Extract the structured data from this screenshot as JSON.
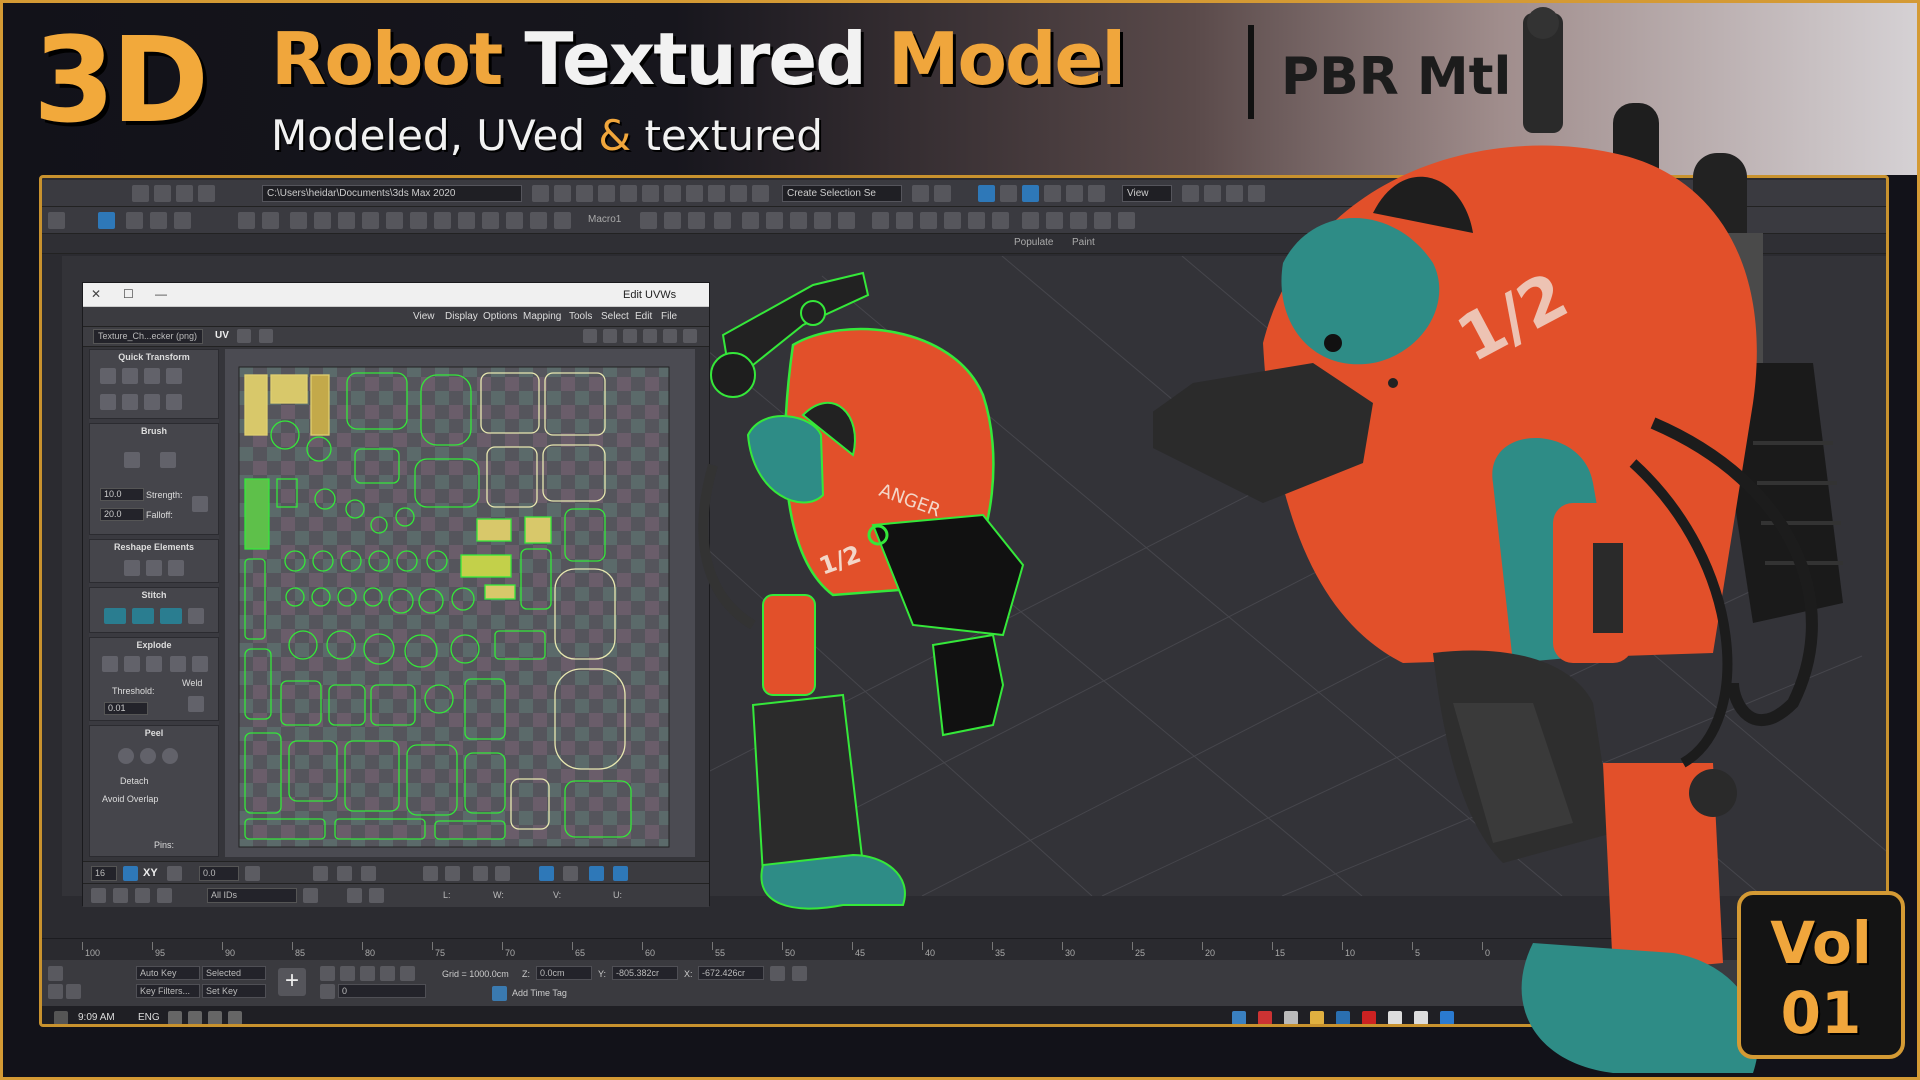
{
  "banner": {
    "title_3d": "3D",
    "title_robot": "Robot",
    "title_textured": "Textured",
    "title_model": "Model",
    "title_pbr": "PBR Mtl",
    "subtitle_a": "Modeled, UVed ",
    "subtitle_amp": "&",
    "subtitle_b": " textured"
  },
  "toolbar": {
    "path": "C:\\Users\\heidar\\Documents\\3ds Max 2020",
    "selection_set": "Create Selection Se",
    "view": "View",
    "macro": "Macro1"
  },
  "ribbon_tabs": [
    "Populate",
    "Paint"
  ],
  "uv_editor": {
    "title": "Edit UVWs",
    "menu": [
      "File",
      "Edit",
      "Select",
      "Tools",
      "Mapping",
      "Options",
      "Display",
      "View"
    ],
    "texture": "Texture_Ch...ecker (png)",
    "uv_label": "UV",
    "rollouts": {
      "quick_transform": "Quick Transform",
      "brush": "Brush",
      "strength_label": "Strength:",
      "strength_value": "10.0",
      "falloff_label": "Falloff:",
      "falloff_value": "20.0",
      "reshape": "Reshape Elements",
      "stitch": "Stitch",
      "explode": "Explode",
      "weld": "Weld",
      "threshold_label": "Threshold:",
      "threshold_value": "0.01",
      "peel": "Peel",
      "detach": "Detach",
      "avoid_overlap": "Avoid Overlap",
      "pins": "Pins:"
    },
    "bottom": {
      "xy": "XY",
      "value": "0.0",
      "u_label": "U:",
      "v_label": "V:",
      "w_label": "W:",
      "l_label": "L:",
      "all_ids": "All IDs",
      "zoom": "16"
    }
  },
  "timeline": {
    "ticks": [
      "0",
      "5",
      "10",
      "15",
      "20",
      "25",
      "30",
      "35",
      "40",
      "45",
      "50",
      "55",
      "60",
      "65",
      "70",
      "75",
      "80",
      "85",
      "90",
      "95",
      "100"
    ]
  },
  "status": {
    "x_label": "X:",
    "x_value": "-672.426cr",
    "y_label": "Y:",
    "y_value": "-805.382cr",
    "z_label": "Z:",
    "z_value": "0.0cm",
    "grid": "Grid = 1000.0cm",
    "add_time_tag": "Add Time Tag",
    "auto_key": "Auto Key",
    "selected": "Selected",
    "set_key": "Set Key",
    "key_filters": "Key Filters...",
    "frame_value": "0"
  },
  "taskbar": {
    "time": "9:09 AM",
    "lang": "ENG"
  },
  "vol": {
    "line1": "Vol",
    "line2": "01"
  },
  "robot_decal": "1/2",
  "robot_text": "ANGER",
  "colors": {
    "accent_orange": "#f0a63c",
    "robot_orange": "#e2502a",
    "robot_teal": "#2e8c86",
    "wire_green": "#35e83a",
    "frame_gold": "#c8922e"
  }
}
